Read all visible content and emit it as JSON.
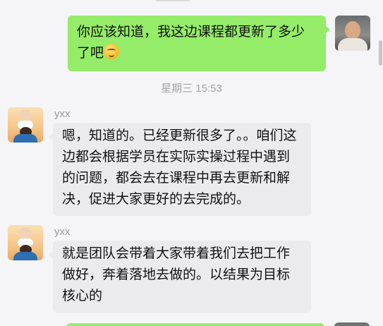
{
  "chat": {
    "self_message": {
      "text": "你应该知道，我这边课程都更新了多少了吧",
      "emoji_icon": "thinking-face-emoji"
    },
    "timestamp": "星期三 15:53",
    "incoming": [
      {
        "sender": "yxx",
        "text": "嗯，知道的。已经更新很多了。。咱们这边都会根据学员在实际实操过程中遇到的问题，都会去在课程中再去更新和解决，促进大家更好的去完成的。"
      },
      {
        "sender": "yxx",
        "text": "就是团队会带着大家带着我们去把工作做好，奔着落地去做的。以结果为目标核心的"
      }
    ]
  },
  "colors": {
    "outgoing_bubble": "#95ec69",
    "incoming_bubble": "#ebebed",
    "background": "#f5f5f7",
    "meta_text": "#a4a4a4"
  }
}
